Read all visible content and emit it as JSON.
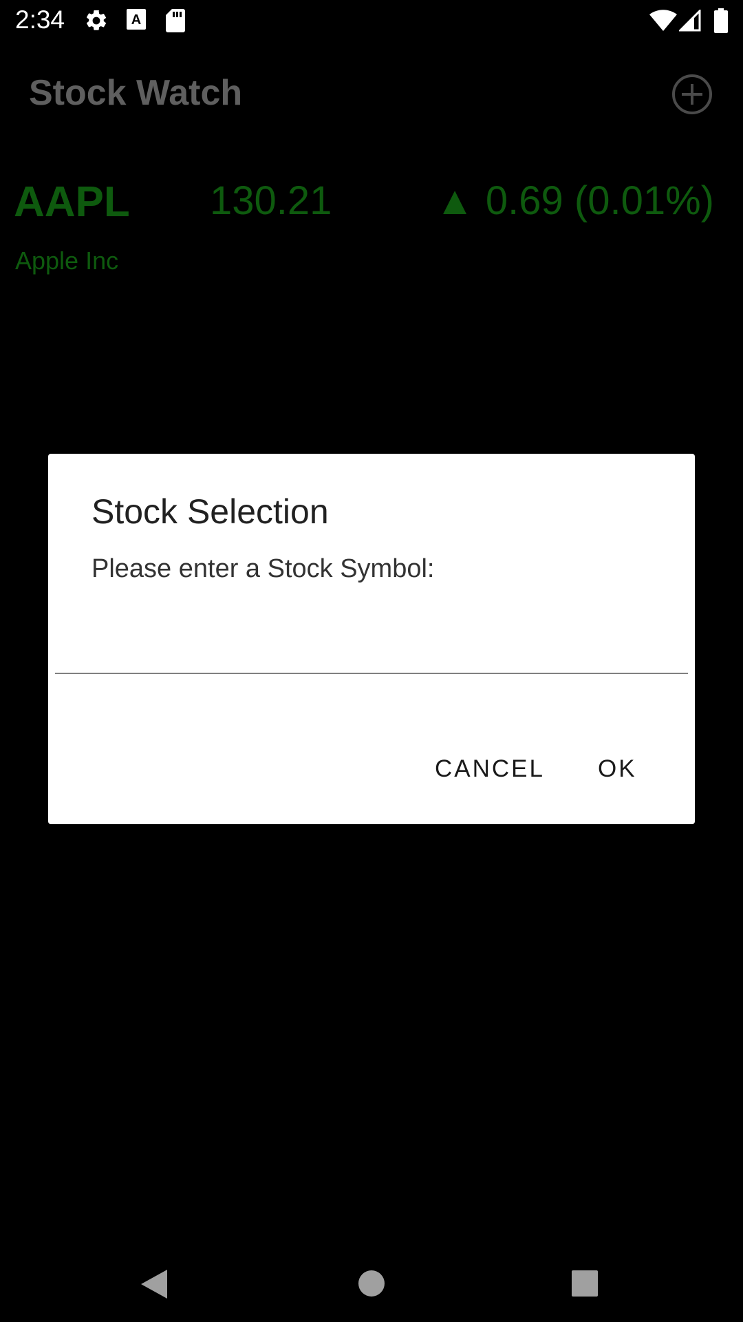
{
  "status_bar": {
    "time": "2:34",
    "icons": [
      "settings-icon",
      "keyboard-a-icon",
      "sd-card-icon",
      "wifi-icon",
      "signal-icon",
      "battery-icon"
    ]
  },
  "app": {
    "title": "Stock Watch",
    "add_icon": "add-circle-icon",
    "stock": {
      "symbol": "AAPL",
      "price": "130.21",
      "change": "▲ 0.69 (0.01%)",
      "name": "Apple Inc",
      "color": "#0e5a0e"
    }
  },
  "dialog": {
    "title": "Stock Selection",
    "message": "Please enter a Stock Symbol:",
    "input_value": "",
    "cancel_label": "CANCEL",
    "ok_label": "OK"
  },
  "nav_bar": {
    "icons": [
      "back-icon",
      "home-icon",
      "recents-icon"
    ]
  }
}
